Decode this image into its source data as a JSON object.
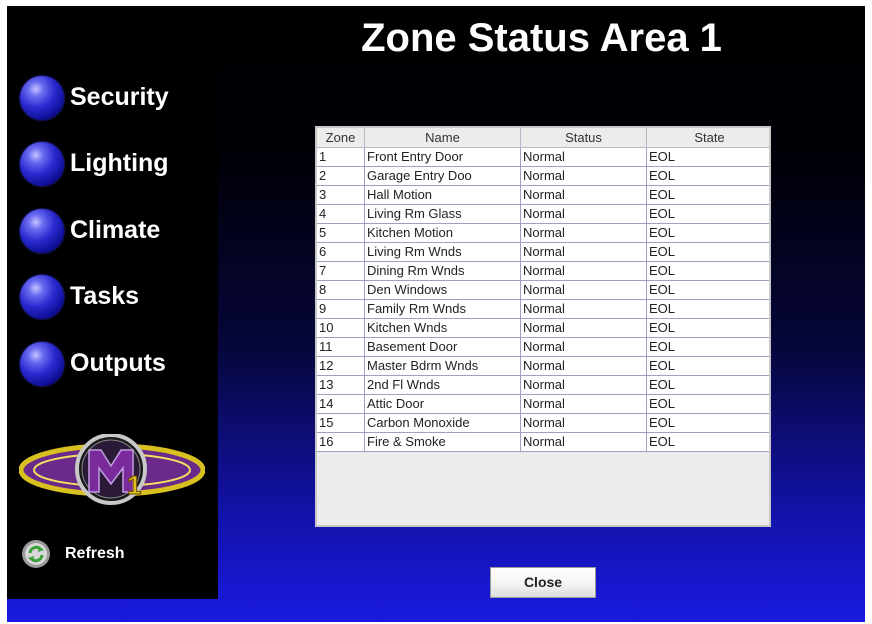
{
  "title": "Zone Status Area 1",
  "nav": [
    {
      "label": "Security"
    },
    {
      "label": "Lighting"
    },
    {
      "label": "Climate"
    },
    {
      "label": "Tasks"
    },
    {
      "label": "Outputs"
    }
  ],
  "refresh_label": "Refresh",
  "logo": {
    "text": "M1"
  },
  "table": {
    "headers": [
      "Zone",
      "Name",
      "Status",
      "State"
    ],
    "rows": [
      [
        "1",
        "Front Entry Door",
        "Normal",
        "EOL"
      ],
      [
        "2",
        "Garage Entry Doo",
        "Normal",
        "EOL"
      ],
      [
        "3",
        "Hall Motion",
        "Normal",
        "EOL"
      ],
      [
        "4",
        "Living Rm Glass",
        "Normal",
        "EOL"
      ],
      [
        "5",
        "Kitchen Motion",
        "Normal",
        "EOL"
      ],
      [
        "6",
        "Living Rm Wnds",
        "Normal",
        "EOL"
      ],
      [
        "7",
        "Dining Rm Wnds",
        "Normal",
        "EOL"
      ],
      [
        "8",
        "Den Windows",
        "Normal",
        "EOL"
      ],
      [
        "9",
        "Family Rm Wnds",
        "Normal",
        "EOL"
      ],
      [
        "10",
        "Kitchen Wnds",
        "Normal",
        "EOL"
      ],
      [
        "11",
        "Basement Door",
        "Normal",
        "EOL"
      ],
      [
        "12",
        "Master Bdrm Wnds",
        "Normal",
        "EOL"
      ],
      [
        "13",
        "2nd Fl Wnds",
        "Normal",
        "EOL"
      ],
      [
        "14",
        "Attic Door",
        "Normal",
        "EOL"
      ],
      [
        "15",
        "Carbon Monoxide",
        "Normal",
        "EOL"
      ],
      [
        "16",
        "Fire & Smoke",
        "Normal",
        "EOL"
      ]
    ]
  },
  "close_label": "Close",
  "icons": {
    "nav": "blue-orb-icon",
    "refresh": "refresh-icon",
    "logo": "m1-logo"
  },
  "colors": {
    "sidebar": "#000000",
    "background_bottom": "#1a1ae0",
    "orb": "#2a2ad0",
    "title_text": "#ffffff"
  }
}
